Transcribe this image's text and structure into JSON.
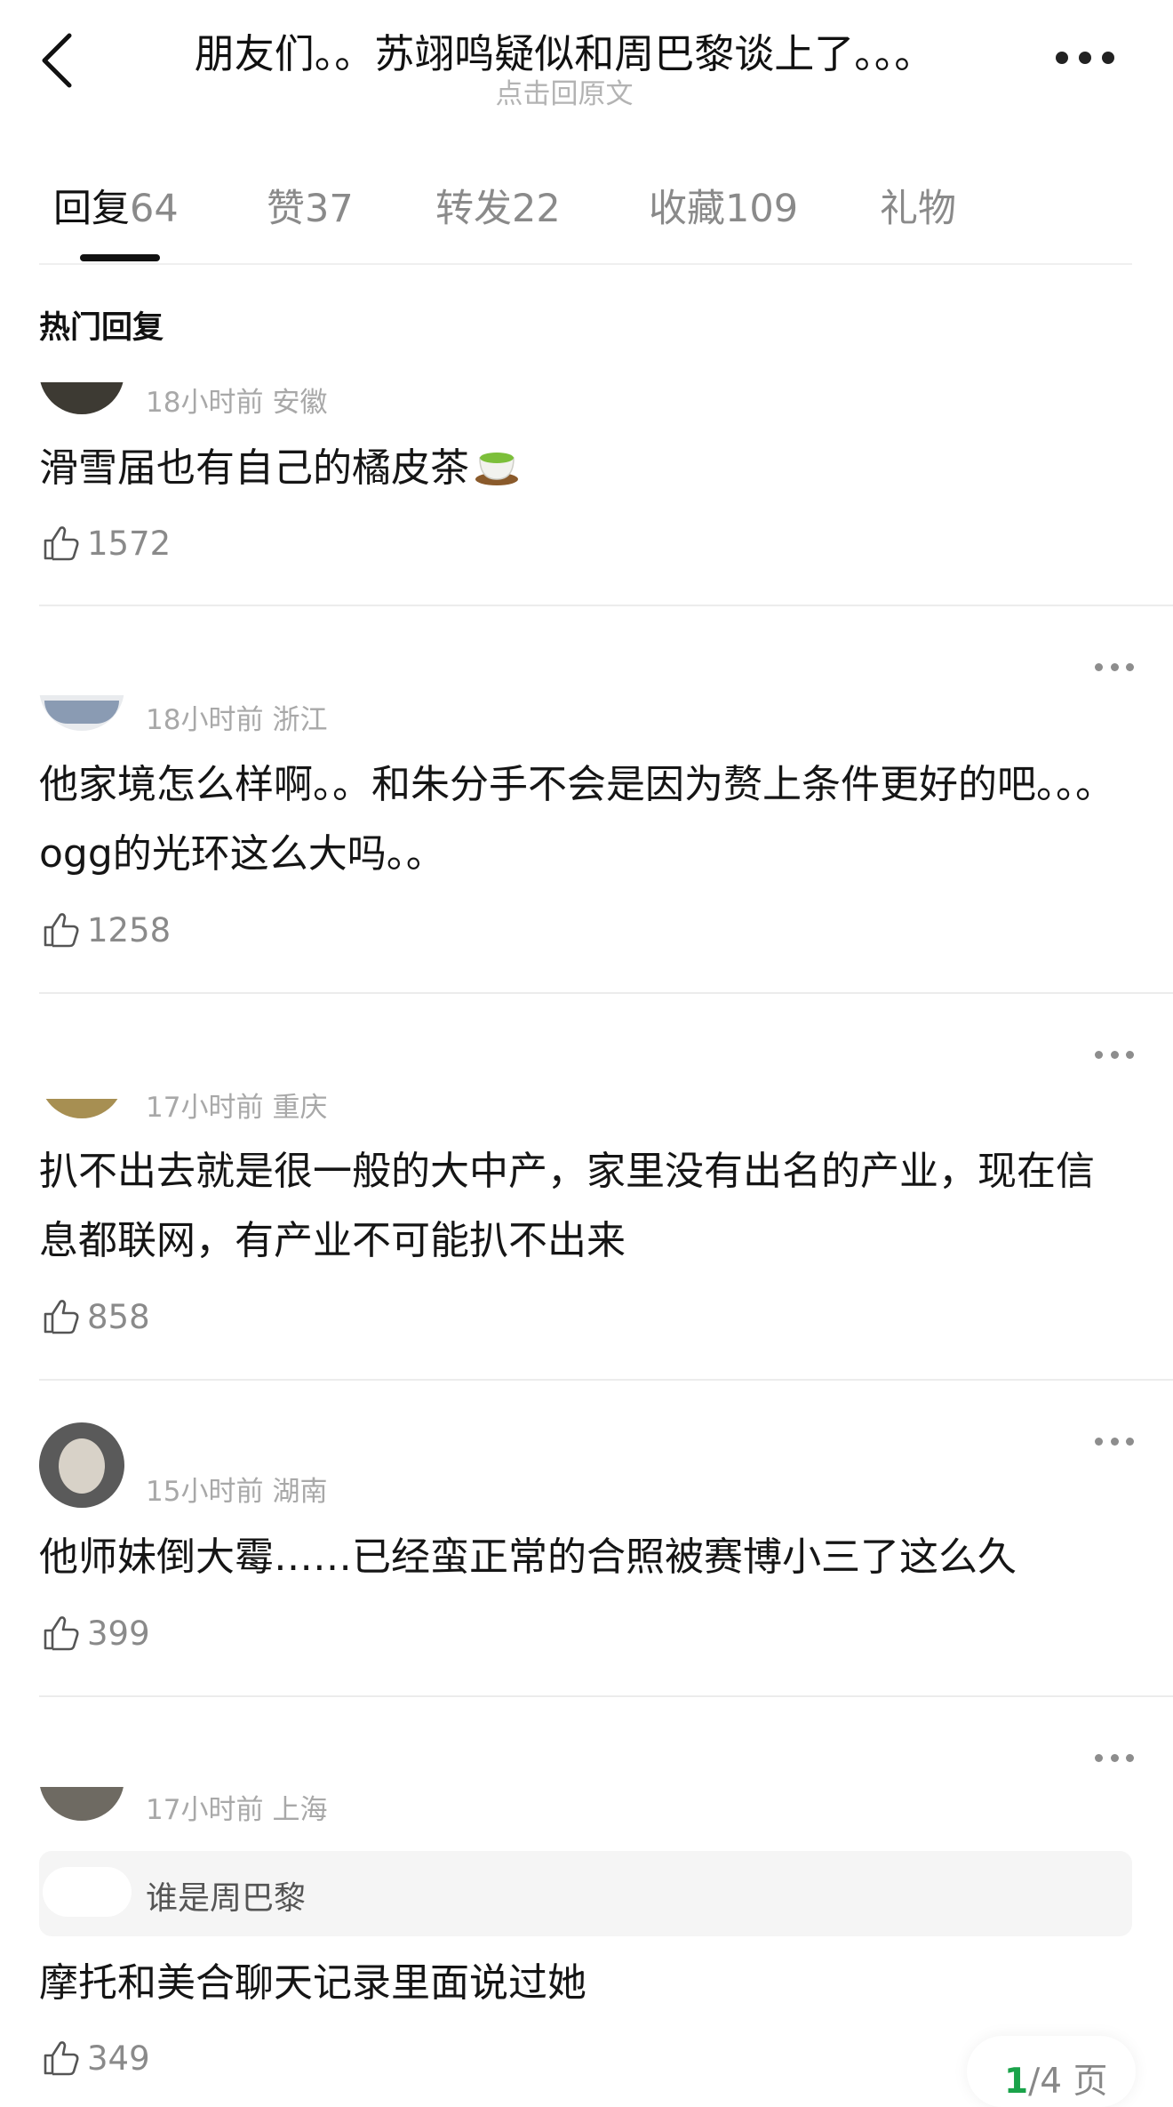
{
  "header": {
    "title": "朋友们。。苏翊鸣疑似和周巴黎谈上了。。。",
    "subtitle": "点击回原文"
  },
  "tabs": [
    {
      "label": "回复",
      "count": "64"
    },
    {
      "label": "赞",
      "count": "37"
    },
    {
      "label": "转发",
      "count": "22"
    },
    {
      "label": "收藏",
      "count": "109"
    },
    {
      "label": "礼物",
      "count": ""
    }
  ],
  "section_title": "热门回复",
  "comments": [
    {
      "time": "18小时前",
      "location": "安徽",
      "text": "滑雪届也有自己的橘皮茶",
      "likes": "1572",
      "emoji": "tea-icon"
    },
    {
      "time": "18小时前",
      "location": "浙江",
      "text": "他家境怎么样啊。。和朱分手不会是因为赘上条件更好的吧。。。ogg的光环这么大吗。。",
      "likes": "1258"
    },
    {
      "time": "17小时前",
      "location": "重庆",
      "text": "扒不出去就是很一般的大中产，家里没有出名的产业，现在信息都联网，有产业不可能扒不出来",
      "likes": "858"
    },
    {
      "time": "15小时前",
      "location": "湖南",
      "text": "他师妹倒大霉……已经蛮正常的合照被赛博小三了这么久",
      "likes": "399"
    },
    {
      "time": "17小时前",
      "location": "上海",
      "quote": "谁是周巴黎",
      "text": "摩托和美合聊天记录里面说过她",
      "likes": "349"
    }
  ],
  "pager": {
    "current": "1",
    "total": "/4 页"
  },
  "colors": {
    "accent_green": "#1aa34a",
    "muted": "#8a8a8a"
  }
}
